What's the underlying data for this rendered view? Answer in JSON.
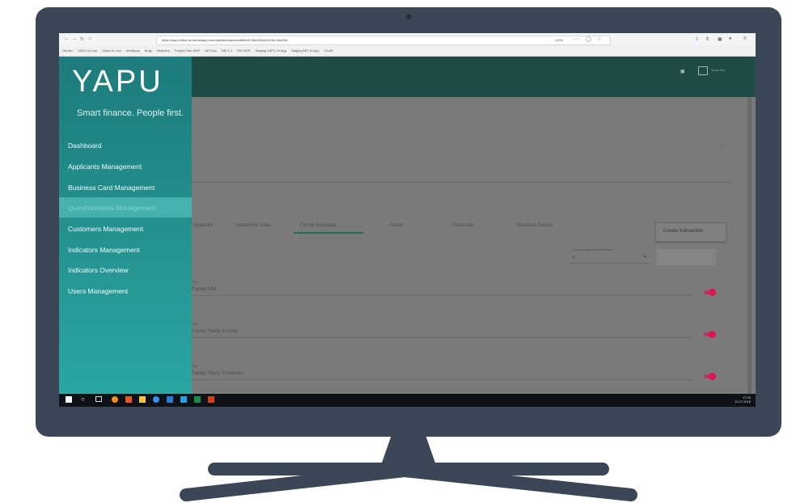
{
  "browser": {
    "url": "https://yapu-client-vs.herokuapp.com/questionnaires/edit/5e5178ef-56fcb-fb10d-0bd93d",
    "zoom": "100%",
    "bookmarks": [
      "Heroku",
      "YAPU UI Live",
      "Client UI Live",
      "Worldpay",
      "Bugs",
      "Redmine",
      "Project Plan MVP",
      "API Doc",
      "DEI 1.1",
      "DEI MVP",
      "Staging YAPU UI App",
      "Staging MFI UI App",
      "CGAP"
    ]
  },
  "app": {
    "logo": "YAPU",
    "tagline": "Smart finance. People first.",
    "header_user": "Yanis Dev"
  },
  "sidebar": {
    "items": [
      {
        "label": "Dashboard",
        "active": false
      },
      {
        "label": "Applicants Management",
        "active": false
      },
      {
        "label": "Business Card Management",
        "active": false
      },
      {
        "label": "Questionnaires Management",
        "active": true
      },
      {
        "label": "Customers Management",
        "active": false
      },
      {
        "label": "Indicators Management",
        "active": false
      },
      {
        "label": "Indicators Overview",
        "active": false
      },
      {
        "label": "Users Management",
        "active": false
      }
    ]
  },
  "content": {
    "create_button": "Create Subsection",
    "tabs": [
      "Applicant",
      "Household Data",
      "Family Indicators",
      "Assets",
      "Financials",
      "Business Details"
    ],
    "select_label": "Choose Subsection Position",
    "select_value": "4",
    "fields": [
      {
        "label": "Title",
        "value": "Family KIM",
        "enabled": true
      },
      {
        "label": "Title",
        "value": "Family Yearly Income",
        "enabled": true
      },
      {
        "label": "Title",
        "value": "Family Yearly Expenses",
        "enabled": true
      }
    ]
  },
  "taskbar": {
    "time": "17:34",
    "date": "11.07.2018"
  }
}
